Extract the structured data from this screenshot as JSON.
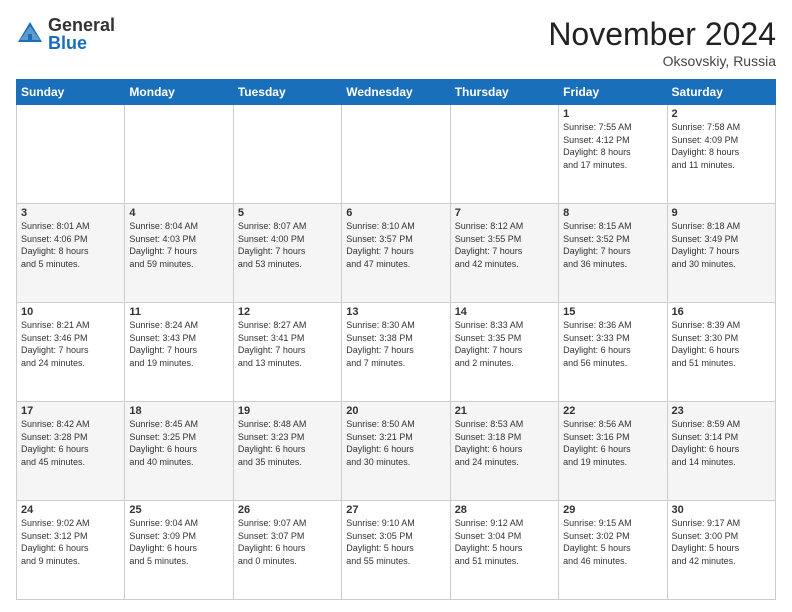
{
  "header": {
    "logo_general": "General",
    "logo_blue": "Blue",
    "month_title": "November 2024",
    "subtitle": "Oksovskiy, Russia"
  },
  "weekdays": [
    "Sunday",
    "Monday",
    "Tuesday",
    "Wednesday",
    "Thursday",
    "Friday",
    "Saturday"
  ],
  "weeks": [
    [
      {
        "day": "",
        "info": ""
      },
      {
        "day": "",
        "info": ""
      },
      {
        "day": "",
        "info": ""
      },
      {
        "day": "",
        "info": ""
      },
      {
        "day": "",
        "info": ""
      },
      {
        "day": "1",
        "info": "Sunrise: 7:55 AM\nSunset: 4:12 PM\nDaylight: 8 hours\nand 17 minutes."
      },
      {
        "day": "2",
        "info": "Sunrise: 7:58 AM\nSunset: 4:09 PM\nDaylight: 8 hours\nand 11 minutes."
      }
    ],
    [
      {
        "day": "3",
        "info": "Sunrise: 8:01 AM\nSunset: 4:06 PM\nDaylight: 8 hours\nand 5 minutes."
      },
      {
        "day": "4",
        "info": "Sunrise: 8:04 AM\nSunset: 4:03 PM\nDaylight: 7 hours\nand 59 minutes."
      },
      {
        "day": "5",
        "info": "Sunrise: 8:07 AM\nSunset: 4:00 PM\nDaylight: 7 hours\nand 53 minutes."
      },
      {
        "day": "6",
        "info": "Sunrise: 8:10 AM\nSunset: 3:57 PM\nDaylight: 7 hours\nand 47 minutes."
      },
      {
        "day": "7",
        "info": "Sunrise: 8:12 AM\nSunset: 3:55 PM\nDaylight: 7 hours\nand 42 minutes."
      },
      {
        "day": "8",
        "info": "Sunrise: 8:15 AM\nSunset: 3:52 PM\nDaylight: 7 hours\nand 36 minutes."
      },
      {
        "day": "9",
        "info": "Sunrise: 8:18 AM\nSunset: 3:49 PM\nDaylight: 7 hours\nand 30 minutes."
      }
    ],
    [
      {
        "day": "10",
        "info": "Sunrise: 8:21 AM\nSunset: 3:46 PM\nDaylight: 7 hours\nand 24 minutes."
      },
      {
        "day": "11",
        "info": "Sunrise: 8:24 AM\nSunset: 3:43 PM\nDaylight: 7 hours\nand 19 minutes."
      },
      {
        "day": "12",
        "info": "Sunrise: 8:27 AM\nSunset: 3:41 PM\nDaylight: 7 hours\nand 13 minutes."
      },
      {
        "day": "13",
        "info": "Sunrise: 8:30 AM\nSunset: 3:38 PM\nDaylight: 7 hours\nand 7 minutes."
      },
      {
        "day": "14",
        "info": "Sunrise: 8:33 AM\nSunset: 3:35 PM\nDaylight: 7 hours\nand 2 minutes."
      },
      {
        "day": "15",
        "info": "Sunrise: 8:36 AM\nSunset: 3:33 PM\nDaylight: 6 hours\nand 56 minutes."
      },
      {
        "day": "16",
        "info": "Sunrise: 8:39 AM\nSunset: 3:30 PM\nDaylight: 6 hours\nand 51 minutes."
      }
    ],
    [
      {
        "day": "17",
        "info": "Sunrise: 8:42 AM\nSunset: 3:28 PM\nDaylight: 6 hours\nand 45 minutes."
      },
      {
        "day": "18",
        "info": "Sunrise: 8:45 AM\nSunset: 3:25 PM\nDaylight: 6 hours\nand 40 minutes."
      },
      {
        "day": "19",
        "info": "Sunrise: 8:48 AM\nSunset: 3:23 PM\nDaylight: 6 hours\nand 35 minutes."
      },
      {
        "day": "20",
        "info": "Sunrise: 8:50 AM\nSunset: 3:21 PM\nDaylight: 6 hours\nand 30 minutes."
      },
      {
        "day": "21",
        "info": "Sunrise: 8:53 AM\nSunset: 3:18 PM\nDaylight: 6 hours\nand 24 minutes."
      },
      {
        "day": "22",
        "info": "Sunrise: 8:56 AM\nSunset: 3:16 PM\nDaylight: 6 hours\nand 19 minutes."
      },
      {
        "day": "23",
        "info": "Sunrise: 8:59 AM\nSunset: 3:14 PM\nDaylight: 6 hours\nand 14 minutes."
      }
    ],
    [
      {
        "day": "24",
        "info": "Sunrise: 9:02 AM\nSunset: 3:12 PM\nDaylight: 6 hours\nand 9 minutes."
      },
      {
        "day": "25",
        "info": "Sunrise: 9:04 AM\nSunset: 3:09 PM\nDaylight: 6 hours\nand 5 minutes."
      },
      {
        "day": "26",
        "info": "Sunrise: 9:07 AM\nSunset: 3:07 PM\nDaylight: 6 hours\nand 0 minutes."
      },
      {
        "day": "27",
        "info": "Sunrise: 9:10 AM\nSunset: 3:05 PM\nDaylight: 5 hours\nand 55 minutes."
      },
      {
        "day": "28",
        "info": "Sunrise: 9:12 AM\nSunset: 3:04 PM\nDaylight: 5 hours\nand 51 minutes."
      },
      {
        "day": "29",
        "info": "Sunrise: 9:15 AM\nSunset: 3:02 PM\nDaylight: 5 hours\nand 46 minutes."
      },
      {
        "day": "30",
        "info": "Sunrise: 9:17 AM\nSunset: 3:00 PM\nDaylight: 5 hours\nand 42 minutes."
      }
    ]
  ]
}
